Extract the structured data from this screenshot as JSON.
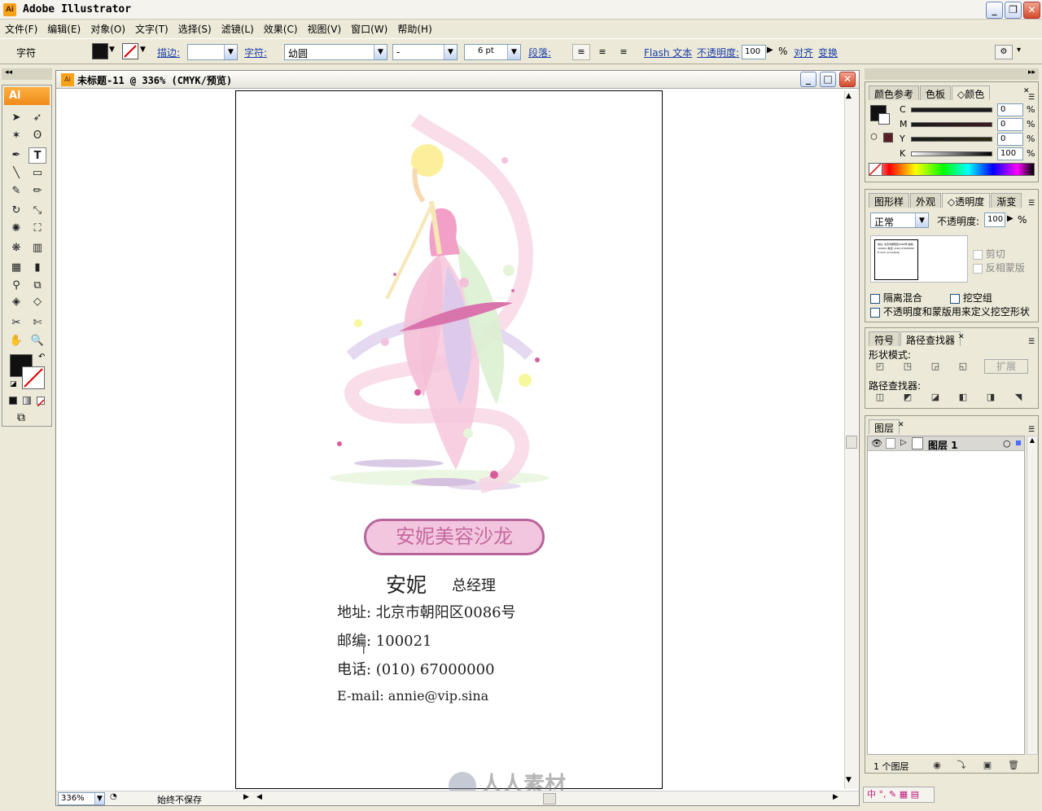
{
  "app": {
    "title": "Adobe Illustrator",
    "icon": "Ai"
  },
  "menu": {
    "items": [
      "文件(F)",
      "编辑(E)",
      "对象(O)",
      "文字(T)",
      "选择(S)",
      "滤镜(L)",
      "效果(C)",
      "视图(V)",
      "窗口(W)",
      "帮助(H)"
    ]
  },
  "control": {
    "mode_label": "字符",
    "stroke_label": "描边:",
    "char_label": "字符:",
    "font_family": "幼圆",
    "font_style": "-",
    "font_size": "6 pt",
    "paragraph_label": "段落:",
    "flash_label": "Flash 文本",
    "opacity_label": "不透明度:",
    "opacity_value": "100",
    "percent": "%",
    "align_label": "对齐",
    "transform_label": "变换"
  },
  "tools": {
    "badge": "Ai"
  },
  "document": {
    "title": "未标题-11 @ 336% (CMYK/预览)",
    "zoom": "336%",
    "status": "始终不保存"
  },
  "card": {
    "banner": "安妮美容沙龙",
    "name": "安妮",
    "position": "总经理",
    "address": "地址: 北京市朝阳区0086号",
    "postcode": "邮编: 100021",
    "phone": "电话:  (010) 67000000",
    "email": "E-mail: annie@vip.sina"
  },
  "watermark": "人人素材",
  "color_panel": {
    "tabs": [
      "颜色参考",
      "色板",
      "◇颜色"
    ],
    "channels": [
      {
        "label": "C",
        "value": "0"
      },
      {
        "label": "M",
        "value": "0"
      },
      {
        "label": "Y",
        "value": "0"
      },
      {
        "label": "K",
        "value": "100"
      }
    ],
    "percent": "%"
  },
  "transparency_panel": {
    "tabs": [
      "图形样",
      "外观",
      "◇透明度",
      "渐变"
    ],
    "blend_mode": "正常",
    "opacity_label": "不透明度:",
    "opacity_value": "100",
    "percent": "%",
    "clip_label": "剪切",
    "invert_label": "反相蒙版",
    "isolate_label": "隔离混合",
    "knockout_label": "挖空组",
    "opacity_mask_label": "不透明度和蒙版用来定义挖空形状",
    "thumbnail_text": "地址: 北京市朝阳区0086号 邮编: 100021 电话: (010) 67000000 E-mail: annie@vip"
  },
  "pathfinder_panel": {
    "tabs": [
      "符号",
      "路径查找器"
    ],
    "shape_modes_label": "形状模式:",
    "pathfinders_label": "路径查找器:",
    "expand_label": "扩展"
  },
  "layers_panel": {
    "tabs": [
      "图层"
    ],
    "layer_name": "图层 1",
    "count": "1 个图层"
  },
  "colors": {
    "accent": "#f7a21b",
    "pink": "#c9679d",
    "banner_fill": "#f2c6de"
  }
}
